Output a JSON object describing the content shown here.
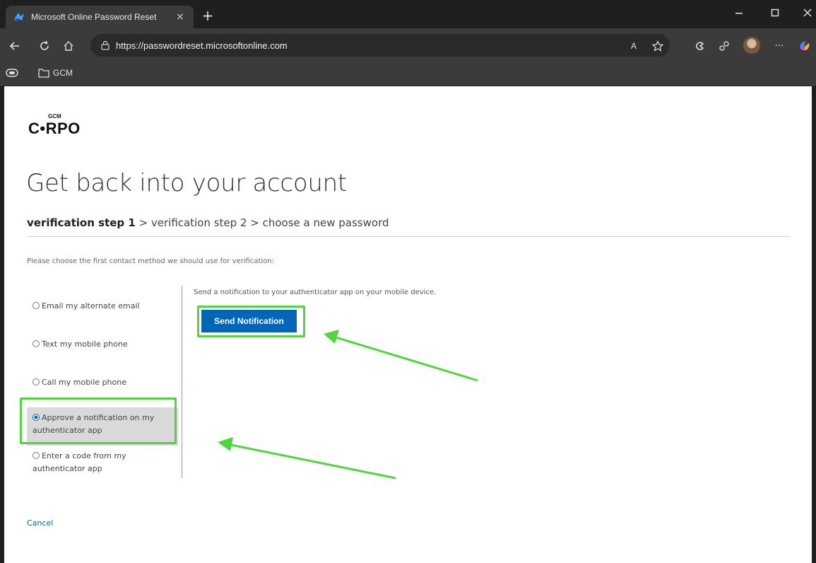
{
  "browser": {
    "tab_title": "Microsoft Online Password Reset",
    "tab_close": "×",
    "new_tab": "+",
    "url": "https://passwordreset.microsoftonline.com",
    "reader_icon_text": "A",
    "more_icon_text": "···",
    "bookmark_folder": "GCM"
  },
  "page": {
    "logo_small": "GCM",
    "logo_main": "C•RPO",
    "title": "Get back into your account",
    "steps": {
      "current": "verification step 1",
      "sep1": " > ",
      "step2": "verification step 2",
      "sep2": " > ",
      "step3": "choose a new password"
    },
    "instruction": "Please choose the first contact method we should use for verification:",
    "methods": [
      {
        "label": "Email my alternate email",
        "selected": false
      },
      {
        "label": "Text my mobile phone",
        "selected": false
      },
      {
        "label": "Call my mobile phone",
        "selected": false
      },
      {
        "label": "Approve a notification on my authenticator app",
        "selected": true
      },
      {
        "label": "Enter a code from my authenticator app",
        "selected": false
      }
    ],
    "detail_text": "Send a notification to your authenticator app on your mobile device.",
    "send_button": "Send Notification",
    "cancel": "Cancel"
  },
  "colors": {
    "accent": "#0067b8",
    "highlight": "#4fd63c",
    "chrome_dark": "#1f1f1f",
    "chrome_mid": "#3b3b3b"
  }
}
